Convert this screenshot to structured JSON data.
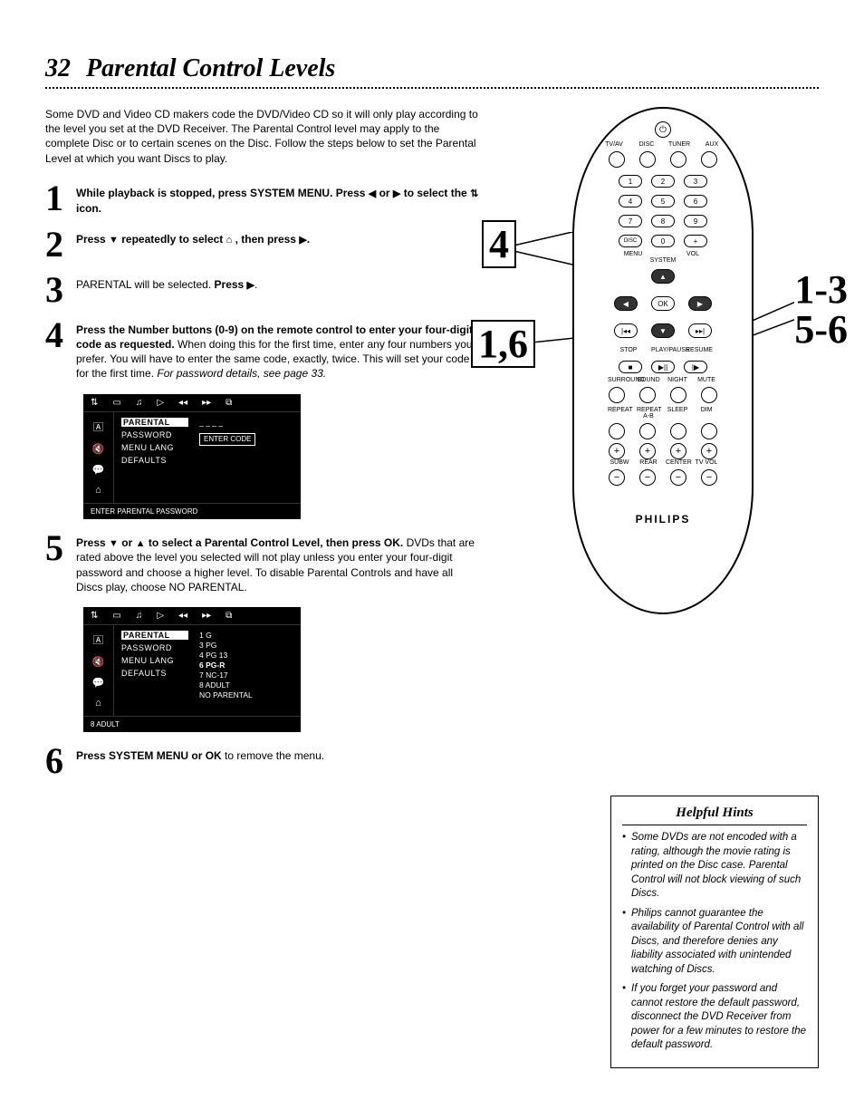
{
  "page": {
    "number": "32",
    "title": "Parental Control Levels"
  },
  "intro": "Some DVD and Video CD makers code the DVD/Video CD so it will only play according to the level you set at the DVD Receiver. The Parental Control level may apply to the complete Disc or to certain scenes on the Disc. Follow the steps below to set the Parental Level at which you want Discs to play.",
  "steps": {
    "s1": {
      "num": "1",
      "b1": "While playback is stopped, press SYSTEM MENU. Press ",
      "g1": "◀",
      "b2": " or ",
      "g2": "▶",
      "b3": " to select the ",
      "g3": "⇅",
      "b4": " icon."
    },
    "s2": {
      "num": "2",
      "b1": "Press ",
      "g1": "▼",
      "b2": " repeatedly to select ",
      "g2": "⌂",
      "b3": " , then press ",
      "g3": "▶",
      "b4": "."
    },
    "s3": {
      "num": "3",
      "t1": "PARENTAL will be selected. ",
      "b1": "Press ",
      "g1": "▶",
      "t2": "."
    },
    "s4": {
      "num": "4",
      "b1": "Press the Number buttons (0-9) on the remote control to enter your four-digit code as requested.",
      "t1": " When doing this for the first time, enter any four numbers you prefer. You will have to enter the same code, exactly, twice. This will set your code for the first time. ",
      "i1": "For password details, see page 33."
    },
    "s5": {
      "num": "5",
      "b1": "Press ",
      "g1": "▼",
      "b2": " or ",
      "g2": "▲",
      "b3": " to select a Parental Control Level, then press OK.",
      "t1": " DVDs that are rated above the level you selected will not play unless you enter your four-digit password and choose a higher level. To disable Parental Controls and have all Discs play, choose NO PARENTAL."
    },
    "s6": {
      "num": "6",
      "b1": "Press SYSTEM MENU or OK",
      "t1": " to remove the menu."
    }
  },
  "osd": {
    "topicons": [
      "⇅",
      "▭",
      "♫",
      "▷",
      "◂◂",
      "▸▸",
      "⧉"
    ],
    "left": [
      "🄰",
      "🔇",
      "💬",
      "⌂"
    ],
    "menu": {
      "parental": "PARENTAL",
      "password": "PASSWORD",
      "menulang": "MENU LANG",
      "defaults": "DEFAULTS"
    },
    "enter": "ENTER CODE",
    "foot1": "ENTER PARENTAL PASSWORD",
    "levels": [
      "1 G",
      "3 PG",
      "4 PG 13",
      "6 PG-R",
      "7 NC-17",
      "8 ADULT",
      "NO PARENTAL"
    ],
    "foot2": "8 ADULT"
  },
  "remote": {
    "toprow": [
      "TV/AV",
      "DISC",
      "TUNER",
      "AUX"
    ],
    "nums": [
      "1",
      "2",
      "3",
      "4",
      "5",
      "6",
      "7",
      "8",
      "9"
    ],
    "bottom": {
      "disc": "DISC",
      "zero": "0",
      "plus": "+"
    },
    "menu": "MENU",
    "system": "SYSTEM",
    "vol": "VOL",
    "ok": "OK",
    "transport": {
      "prev": "|◂◂",
      "next": "▸▸|",
      "down": "▼",
      "up": "▲",
      "left": "◀",
      "right": "▶"
    },
    "row3lbl": [
      "STOP",
      "PLAY/PAUSE",
      "RESUME"
    ],
    "row3": [
      "■",
      "▶||",
      "|▶"
    ],
    "row4lbl": [
      "SURROUND",
      "SOUND",
      "NIGHT",
      "MUTE"
    ],
    "row5lbl": [
      "REPEAT",
      "REPEAT A-B",
      "SLEEP",
      "DIM"
    ],
    "row6lbl": [
      "SUBW",
      "REAR",
      "CENTER",
      "TV VOL"
    ],
    "brand": "PHILIPS"
  },
  "callouts": {
    "c1": "4",
    "c2": "1,6",
    "c3a": "1-3",
    "c3b": "5-6"
  },
  "hints": {
    "title": "Helpful Hints",
    "h1": "Some DVDs are not encoded with a rating, although the movie rating is printed on the Disc case. Parental Control will not block viewing of such Discs.",
    "h2": "Philips cannot guarantee the availability of Parental Control with all Discs, and therefore denies any liability associated with unintended watching of Discs.",
    "h3": "If you forget your password and cannot restore the default password, disconnect the DVD Receiver from power for a few minutes to restore the default password."
  }
}
